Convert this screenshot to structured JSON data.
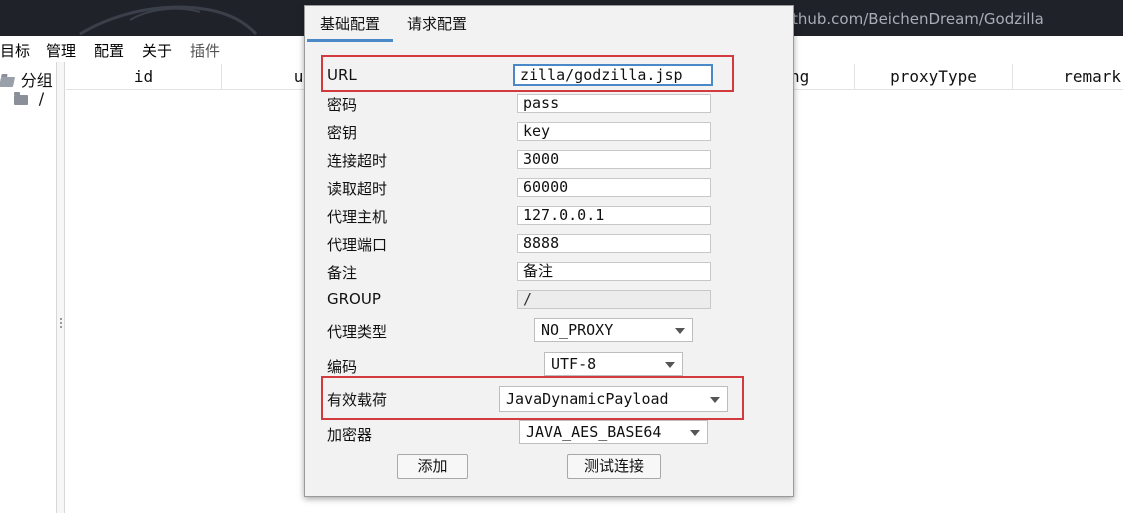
{
  "window": {
    "title_fragment": "thub.com/BeichenDream/Godzilla"
  },
  "menu": {
    "items": [
      "目标",
      "管理",
      "配置",
      "关于",
      "插件"
    ]
  },
  "tree": {
    "root_label": "分组",
    "child_label": "/"
  },
  "table": {
    "columns": [
      "id",
      "ur",
      "ng",
      "proxyType",
      "remark"
    ]
  },
  "dialog": {
    "tabs": [
      {
        "label": "基础配置",
        "active": true
      },
      {
        "label": "请求配置",
        "active": false
      }
    ],
    "fields": {
      "url": {
        "label": "URL",
        "value": "zilla/godzilla.jsp"
      },
      "password": {
        "label": "密码",
        "value": "pass"
      },
      "key": {
        "label": "密钥",
        "value": "key"
      },
      "connect_timeout": {
        "label": "连接超时",
        "value": "3000"
      },
      "read_timeout": {
        "label": "读取超时",
        "value": "60000"
      },
      "proxy_host": {
        "label": "代理主机",
        "value": "127.0.0.1"
      },
      "proxy_port": {
        "label": "代理端口",
        "value": "8888"
      },
      "remark": {
        "label": "备注",
        "value": "备注"
      },
      "group": {
        "label": "GROUP",
        "value": "/"
      }
    },
    "combos": {
      "proxy_type": {
        "label": "代理类型",
        "value": "NO_PROXY"
      },
      "encoding": {
        "label": "编码",
        "value": "UTF-8"
      },
      "payload": {
        "label": "有效载荷",
        "value": "JavaDynamicPayload"
      },
      "cryptor": {
        "label": "加密器",
        "value": "JAVA_AES_BASE64"
      }
    },
    "buttons": {
      "add": "添加",
      "test_connection": "测试连接"
    }
  },
  "colors": {
    "titlebar": "#1f2229",
    "tab_accent": "#4a88c7",
    "highlight_box": "#d33a40",
    "dialog_bg": "#f2f2f2"
  }
}
